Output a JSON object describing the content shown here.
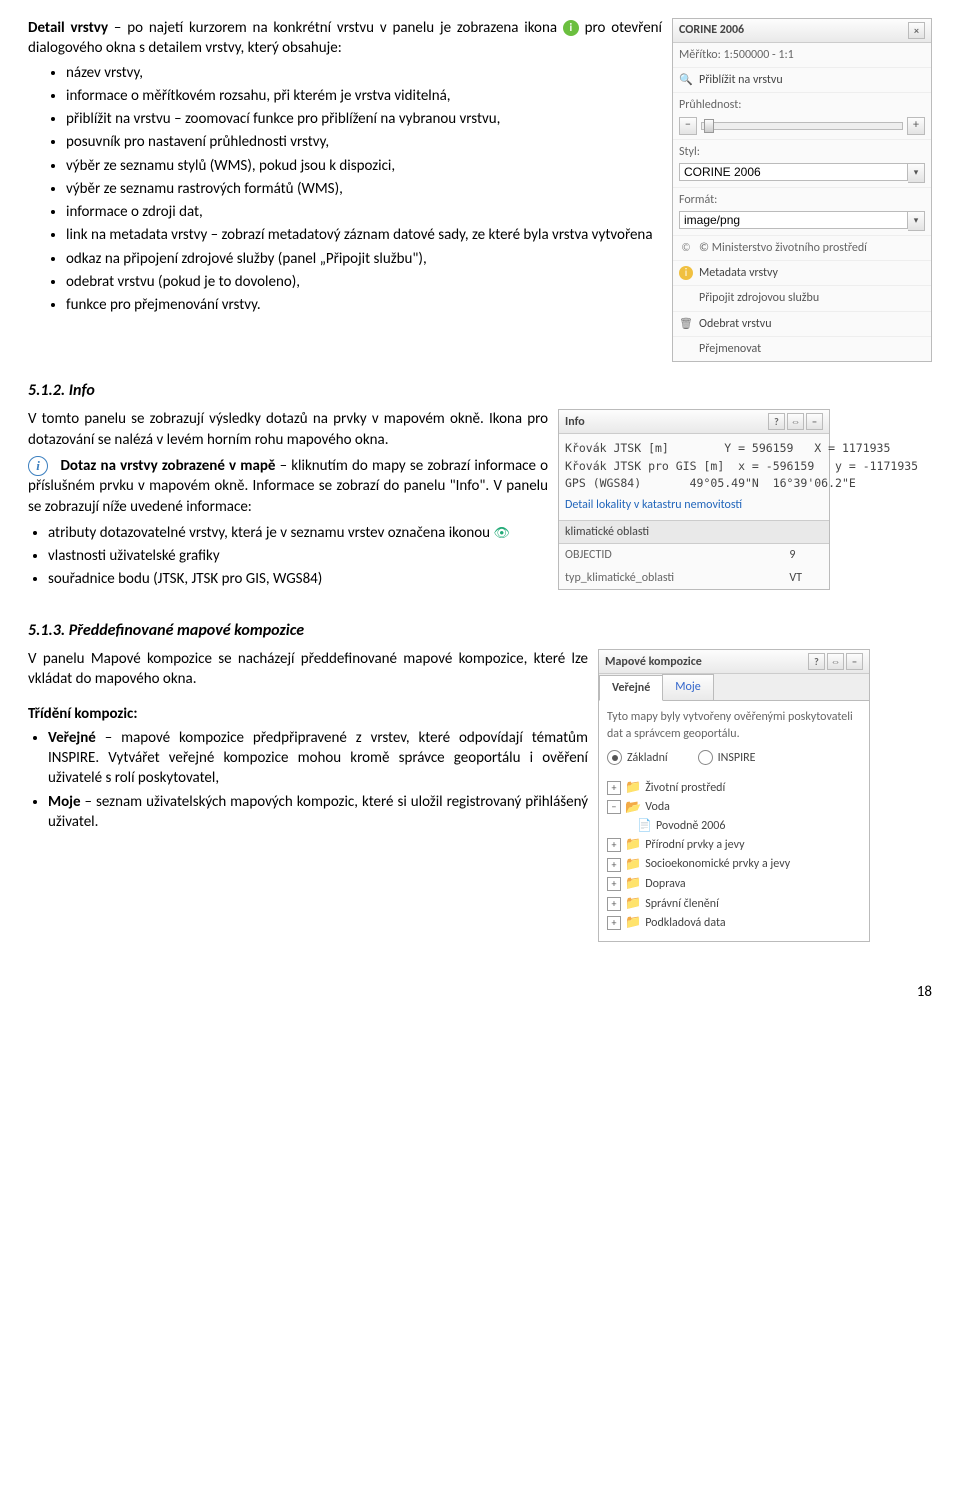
{
  "section1": {
    "intro_1": "Detail vrstvy",
    "intro_2": " – po najetí kurzorem na konkrétní vrstvu v panelu je zobrazena ikona ",
    "intro_3": " pro otevření dialogového okna s detailem vrstvy, který obsahuje:",
    "bullets": [
      "název vrstvy,",
      "informace o měřítkovém rozsahu, při kterém je vrstva viditelná,",
      "přiblížit na vrstvu – zoomovací funkce pro přiblížení na vybranou vrstvu,",
      "posuvník pro nastavení průhlednosti vrstvy,",
      "výběr ze seznamu stylů (WMS), pokud jsou k dispozici,",
      "výběr ze seznamu rastrových formátů (WMS),",
      "informace o zdroji dat,",
      "link na metadata vrstvy – zobrazí metadatový záznam datové sady, ze které byla vrstva vytvořena",
      "odkaz na připojení zdrojové služby (panel „Připojit službu\"),",
      "odebrat vrstvu (pokud je to dovoleno),",
      "funkce pro přejmenování vrstvy."
    ]
  },
  "layer_panel": {
    "title": "CORINE 2006",
    "scale": "Měřítko: 1:500000 - 1:1",
    "zoom": "Přiblížit na vrstvu",
    "transparency": "Průhlednost:",
    "style_label": "Styl:",
    "style_value": "CORINE 2006",
    "format_label": "Formát:",
    "format_value": "image/png",
    "copyright": "© Ministerstvo životního prostředí",
    "metadata": "Metadata vrstvy",
    "attach": "Připojit zdrojovou službu",
    "remove": "Odebrat vrstvu",
    "rename": "Přejmenovat"
  },
  "section2": {
    "heading": "5.1.2.   Info",
    "para1": "V tomto panelu se zobrazují výsledky dotazů na prvky v mapovém okně. Ikona pro dotazování se nalézá v levém horním rohu mapového okna.",
    "query_bold": "Dotaz na vrstvy zobrazené v mapě",
    "para2": " – kliknutím do mapy se zobrazí informace o příslušném prvku v mapovém okně. Informace se zobrazí do panelu \"Info\". V panelu se zobrazují níže uvedené informace:",
    "bullets": [
      "atributy dotazovatelné vrstvy, která je v seznamu vrstev označena ikonou",
      "vlastnosti uživatelské grafiky",
      "souřadnice bodu (JTSK, JTSK pro GIS, WGS84)"
    ]
  },
  "info_panel": {
    "title": "Info",
    "row1": "Křovák JTSK [m]        Y = 596159   X = 1171935",
    "row2": "Křovák JTSK pro GIS [m]  x = -596159   y = -1171935",
    "row3": "GPS (WGS84)       49°05.49\"N  16°39'06.2\"E",
    "detail": "Detail lokality v katastru nemovitostí",
    "subheader": "klimatické oblasti",
    "obj_label": "OBJECTID",
    "obj_value": "9",
    "typ_label": "typ_klimatické_oblasti",
    "typ_value": "VT"
  },
  "section3": {
    "heading": "5.1.3.   Předdefinované mapové kompozice",
    "para1": "V panelu Mapové kompozice se nacházejí předdefinované mapové kompozice, které lze vkládat do mapového okna.",
    "sort_title": "Třídění kompozic:",
    "b1_strong": "Veřejné",
    "b1_rest": " – mapové kompozice předpřipravené z vrstev, které odpovídají tématům INSPIRE. Vytvářet veřejné kompozice mohou kromě správce geoportálu i ověření uživatelé s rolí poskytovatel,",
    "b2_strong": "Moje",
    "b2_rest": " – seznam uživatelských mapových kompozic, které si uložil registrovaný přihlášený uživatel."
  },
  "comp_panel": {
    "title": "Mapové kompozice",
    "tab_public": "Veřejné",
    "tab_mine": "Moje",
    "desc": "Tyto mapy byly vytvořeny ověřenými poskytovateli dat a správcem geoportálu.",
    "radio1": "Základní",
    "radio2": "INSPIRE",
    "tree": {
      "n1": "Životní prostředí",
      "n2": "Voda",
      "n2a": "Povodně 2006",
      "n3": "Přírodní prvky a jevy",
      "n4": "Socioekonomické prvky a jevy",
      "n5": "Doprava",
      "n6": "Správní členění",
      "n7": "Podkladová data"
    }
  },
  "page_number": "18"
}
